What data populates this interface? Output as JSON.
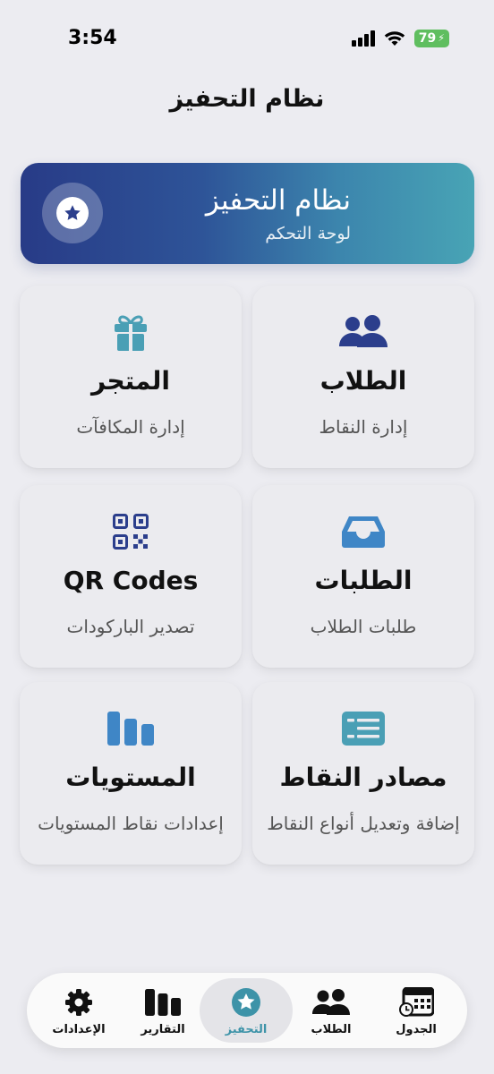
{
  "status": {
    "time": "3:54",
    "battery": "79"
  },
  "header": {
    "title": "نظام التحفيز"
  },
  "banner": {
    "title": "نظام التحفيز",
    "subtitle": "لوحة التحكم",
    "icon": "star-icon"
  },
  "cards": [
    {
      "title": "الطلاب",
      "subtitle": "إدارة النقاط",
      "icon": "users-icon",
      "color": "#2b3e8c"
    },
    {
      "title": "المتجر",
      "subtitle": "إدارة المكافآت",
      "icon": "gift-icon",
      "color": "#4a9fb5"
    },
    {
      "title": "الطلبات",
      "subtitle": "طلبات الطلاب",
      "icon": "inbox-icon",
      "color": "#3f86c6"
    },
    {
      "title": "QR Codes",
      "subtitle": "تصدير الباركودات",
      "icon": "qr-code-icon",
      "color": "#2b3e8c"
    },
    {
      "title": "مصادر النقاط",
      "subtitle": "إضافة وتعديل أنواع النقاط",
      "icon": "list-icon",
      "color": "#4a9fb5"
    },
    {
      "title": "المستويات",
      "subtitle": "إعدادات نقاط المستويات",
      "icon": "bar-chart-icon",
      "color": "#3f86c6"
    }
  ],
  "tabs": [
    {
      "label": "الإعدادات",
      "icon": "gear-icon",
      "active": false
    },
    {
      "label": "التقارير",
      "icon": "reports-icon",
      "active": false
    },
    {
      "label": "التحفيز",
      "icon": "star-icon",
      "active": true
    },
    {
      "label": "الطلاب",
      "icon": "users-icon",
      "active": false
    },
    {
      "label": "الجدول",
      "icon": "calendar-clock-icon",
      "active": false
    }
  ],
  "colors": {
    "accent": "#3d93a8",
    "navy": "#2b3e8c",
    "background": "#ececf1"
  }
}
